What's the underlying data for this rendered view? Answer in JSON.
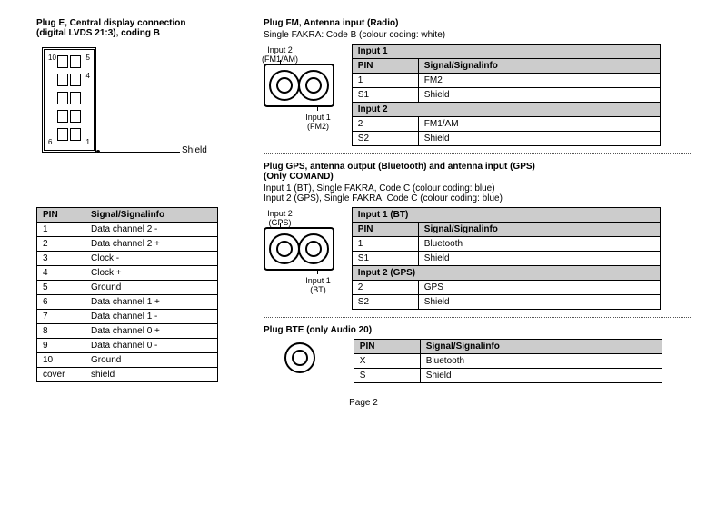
{
  "page_label": "Page 2",
  "left": {
    "title_line1": "Plug E, Central display connection",
    "title_line2": "(digital LVDS 21:3), coding B",
    "shield_label": "Shield",
    "pin_labels": {
      "p10": "10",
      "p5": "5",
      "p4": "4",
      "p6": "6",
      "p1": "1"
    },
    "table": {
      "head": {
        "pin": "PIN",
        "sig": "Signal/Signalinfo"
      },
      "rows": [
        {
          "pin": "1",
          "sig": "Data channel 2 -"
        },
        {
          "pin": "2",
          "sig": "Data channel 2 +"
        },
        {
          "pin": "3",
          "sig": "Clock -"
        },
        {
          "pin": "4",
          "sig": "Clock +"
        },
        {
          "pin": "5",
          "sig": "Ground"
        },
        {
          "pin": "6",
          "sig": "Data channel 1 +"
        },
        {
          "pin": "7",
          "sig": "Data channel 1 -"
        },
        {
          "pin": "8",
          "sig": "Data channel 0 +"
        },
        {
          "pin": "9",
          "sig": "Data channel 0 -"
        },
        {
          "pin": "10",
          "sig": "Ground"
        },
        {
          "pin": "cover",
          "sig": "shield"
        }
      ]
    }
  },
  "fm": {
    "title": "Plug FM, Antenna input (Radio)",
    "subtitle": "Single FAKRA: Code B (colour coding: white)",
    "diagram": {
      "top_label": "Input 2\n(FM1/AM)",
      "bottom_label": "Input 1\n(FM2)"
    },
    "table": {
      "h_input1": "Input 1",
      "h_pin": "PIN",
      "h_sig": "Signal/Signalinfo",
      "r1": {
        "pin": "1",
        "sig": "FM2"
      },
      "r2": {
        "pin": "S1",
        "sig": "Shield"
      },
      "h_input2": "Input 2",
      "r3": {
        "pin": "2",
        "sig": "FM1/AM"
      },
      "r4": {
        "pin": "S2",
        "sig": "Shield"
      }
    }
  },
  "gps": {
    "title_line1": "Plug GPS, antenna output (Bluetooth) and antenna input (GPS)",
    "title_line2": "(Only COMAND)",
    "sub1": "Input 1 (BT), Single FAKRA, Code C (colour coding: blue)",
    "sub2": "Input 2 (GPS), Single FAKRA, Code C (colour coding: blue)",
    "diagram": {
      "top_label": "Input 2\n(GPS)",
      "bottom_label": "Input 1\n(BT)"
    },
    "table": {
      "h_input1": "Input 1 (BT)",
      "h_pin": "PIN",
      "h_sig": "Signal/Signalinfo",
      "r1": {
        "pin": "1",
        "sig": "Bluetooth"
      },
      "r2": {
        "pin": "S1",
        "sig": "Shield"
      },
      "h_input2": "Input 2 (GPS)",
      "r3": {
        "pin": "2",
        "sig": "GPS"
      },
      "r4": {
        "pin": "S2",
        "sig": "Shield"
      }
    }
  },
  "bte": {
    "title": "Plug BTE (only Audio 20)",
    "table": {
      "h_pin": "PIN",
      "h_sig": "Signal/Signalinfo",
      "r1": {
        "pin": "X",
        "sig": "Bluetooth"
      },
      "r2": {
        "pin": "S",
        "sig": "Shield"
      }
    }
  }
}
